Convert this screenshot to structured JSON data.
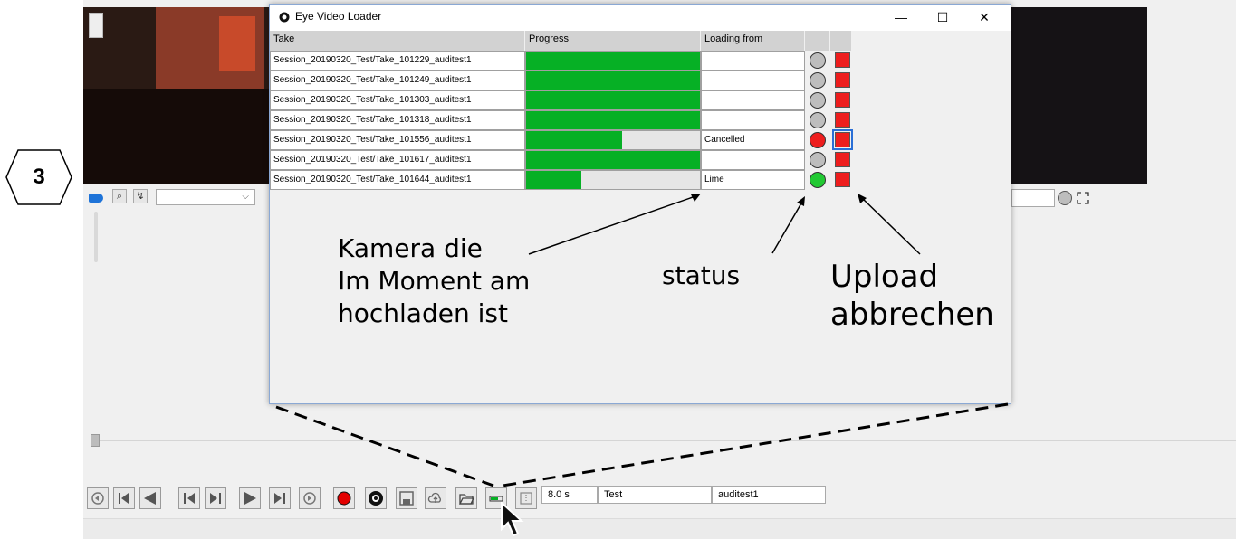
{
  "step_badge": "3",
  "dialog": {
    "title": "Eye Video Loader",
    "window_controls": {
      "minimize": "—",
      "maximize": "☐",
      "close": "✕"
    }
  },
  "table": {
    "headers": [
      "Take",
      "Progress",
      "Loading from",
      "",
      ""
    ],
    "rows": [
      {
        "take": "Session_20190320_Test/Take_101229_auditest1",
        "progress": 1.0,
        "loading_from": "",
        "status": "gray"
      },
      {
        "take": "Session_20190320_Test/Take_101249_auditest1",
        "progress": 1.0,
        "loading_from": "",
        "status": "gray"
      },
      {
        "take": "Session_20190320_Test/Take_101303_auditest1",
        "progress": 1.0,
        "loading_from": "",
        "status": "gray"
      },
      {
        "take": "Session_20190320_Test/Take_101318_auditest1",
        "progress": 1.0,
        "loading_from": "",
        "status": "gray"
      },
      {
        "take": "Session_20190320_Test/Take_101556_auditest1",
        "progress": 0.55,
        "loading_from": "Cancelled",
        "status": "red"
      },
      {
        "take": "Session_20190320_Test/Take_101617_auditest1",
        "progress": 1.0,
        "loading_from": "",
        "status": "gray"
      },
      {
        "take": "Session_20190320_Test/Take_101644_auditest1",
        "progress": 0.32,
        "loading_from": "Lime",
        "status": "green"
      }
    ]
  },
  "annotations": {
    "camera": "Kamera die\nIm Moment am\nhochladen ist",
    "status": "status",
    "cancel": "Upload\nabbrechen"
  },
  "toolbar": {
    "duration": "8.0 s",
    "session": "Test",
    "user": "auditest1"
  },
  "colors": {
    "progress_fill": "#06b025",
    "status_gray": "#bdbdbd",
    "status_red": "#ee1e1e",
    "status_green": "#22c933",
    "stop_red": "#ee1e1e",
    "accent_blue": "#1e73d8"
  }
}
